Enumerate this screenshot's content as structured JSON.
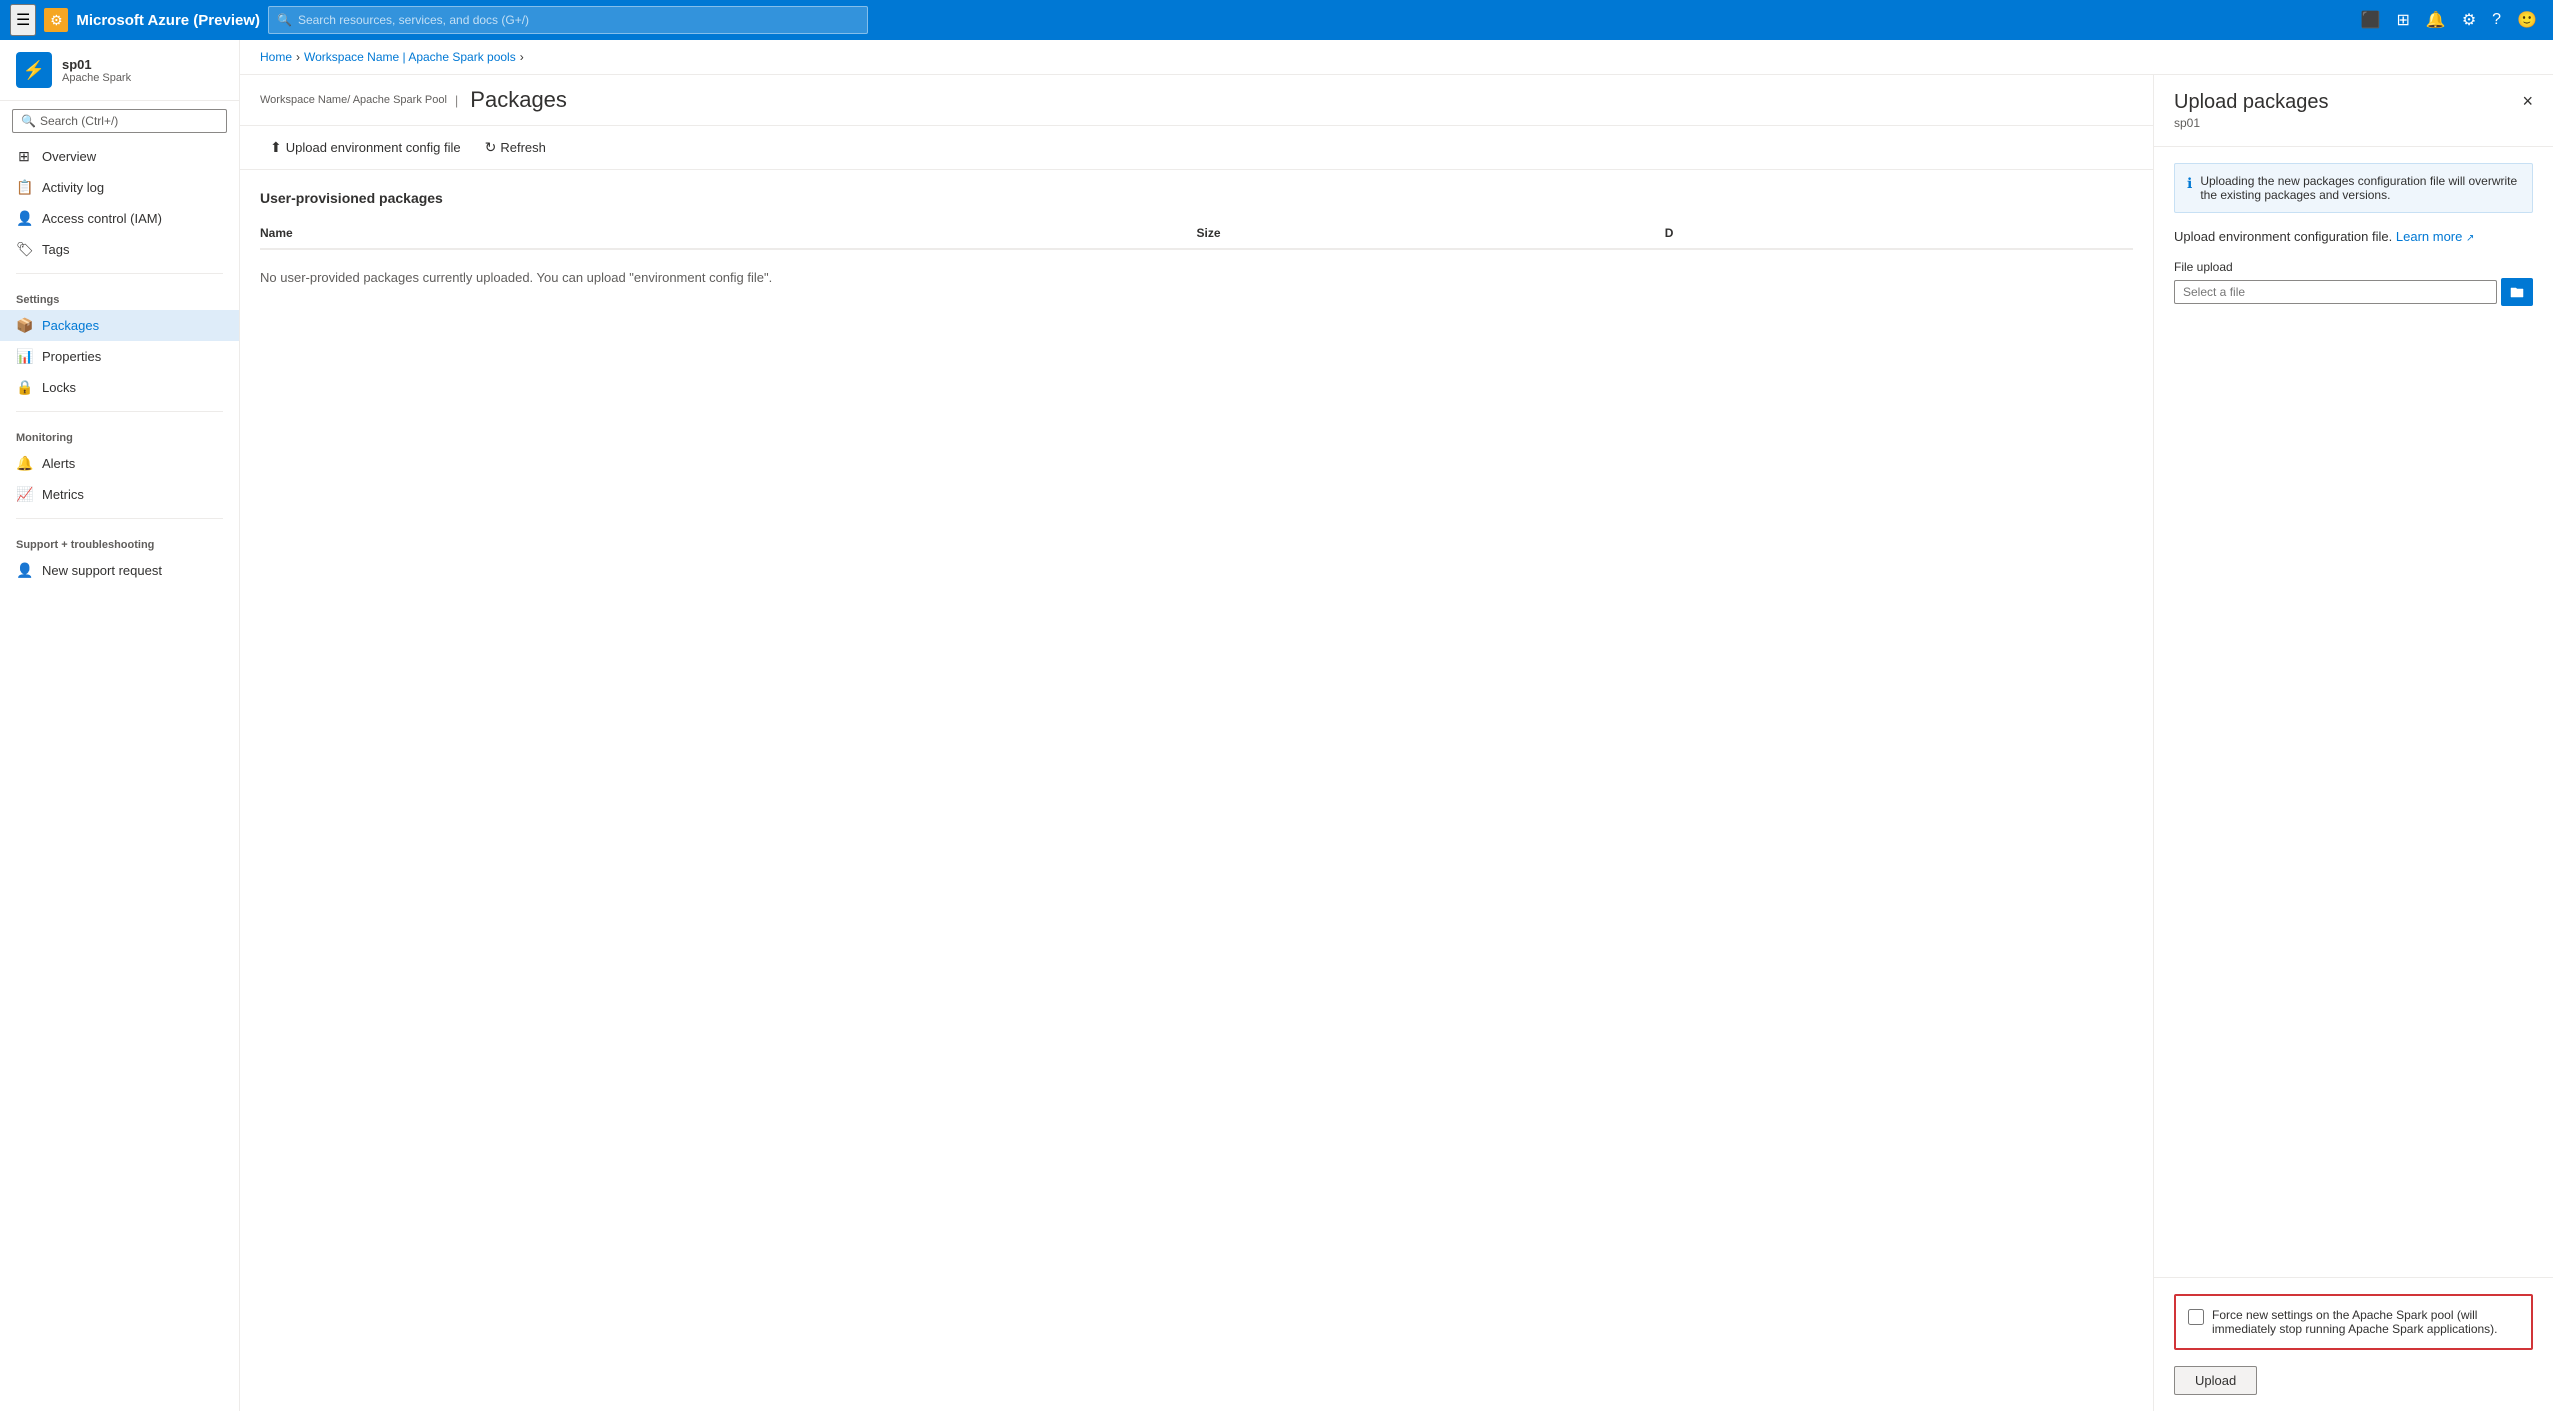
{
  "topbar": {
    "title": "Microsoft Azure (Preview)",
    "search_placeholder": "Search resources, services, and docs (G+/)",
    "logo_emoji": "⚙"
  },
  "breadcrumb": {
    "items": [
      "Home",
      "Workspace Name",
      "Apache Spark pools"
    ],
    "separators": [
      ">",
      ">",
      ">"
    ]
  },
  "resource": {
    "name": "sp01",
    "subtitle": "Apache Spark",
    "breadcrumb_detail": "Workspace Name/ Apache Spark Pool"
  },
  "page": {
    "title": "Packages",
    "search_placeholder": "Search (Ctrl+/)"
  },
  "toolbar": {
    "upload_label": "Upload environment config file",
    "refresh_label": "Refresh"
  },
  "sidebar": {
    "search_placeholder": "Search (Ctrl+/)",
    "nav_items": [
      {
        "id": "overview",
        "label": "Overview",
        "icon": "⊞"
      },
      {
        "id": "activity-log",
        "label": "Activity log",
        "icon": "📋"
      },
      {
        "id": "access-control",
        "label": "Access control (IAM)",
        "icon": "👤"
      },
      {
        "id": "tags",
        "label": "Tags",
        "icon": "🏷"
      }
    ],
    "settings_label": "Settings",
    "settings_items": [
      {
        "id": "packages",
        "label": "Packages",
        "icon": "📦",
        "active": true
      },
      {
        "id": "properties",
        "label": "Properties",
        "icon": "📊"
      },
      {
        "id": "locks",
        "label": "Locks",
        "icon": "🔒"
      }
    ],
    "monitoring_label": "Monitoring",
    "monitoring_items": [
      {
        "id": "alerts",
        "label": "Alerts",
        "icon": "🔔"
      },
      {
        "id": "metrics",
        "label": "Metrics",
        "icon": "📈"
      }
    ],
    "support_label": "Support + troubleshooting",
    "support_items": [
      {
        "id": "new-support-request",
        "label": "New support request",
        "icon": "👤"
      }
    ]
  },
  "main": {
    "section_title": "User-provisioned packages",
    "table": {
      "columns": [
        "Name",
        "Size",
        "D"
      ],
      "empty_message": "No user-provided packages currently uploaded. You can upload \"environment config file\"."
    }
  },
  "right_panel": {
    "title": "Upload packages",
    "subtitle": "sp01",
    "close_label": "×",
    "info_message": "Uploading the new packages configuration file will overwrite the existing packages and versions.",
    "upload_env_label": "Upload environment configuration file.",
    "learn_more_label": "Learn more",
    "file_upload_label": "File upload",
    "file_input_placeholder": "Select a file",
    "force_settings_label": "Force new settings on the Apache Spark pool (will immediately stop running Apache Spark applications).",
    "upload_button_label": "Upload"
  }
}
